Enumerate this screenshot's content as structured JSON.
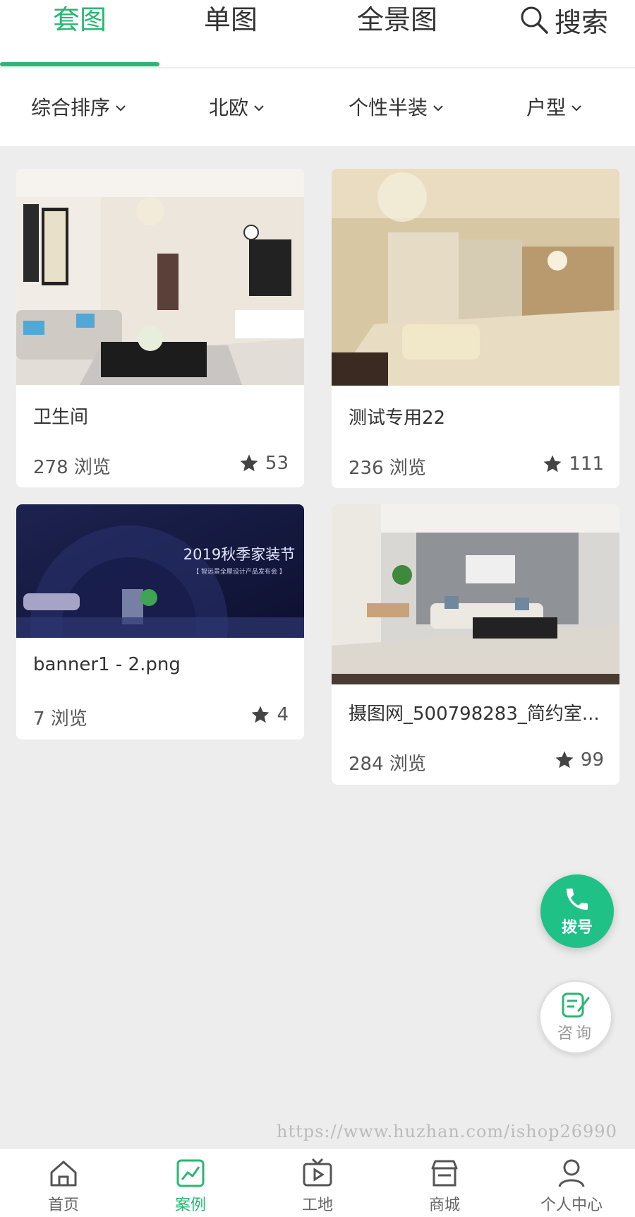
{
  "tabs": {
    "items": [
      {
        "label": "套图",
        "active": true
      },
      {
        "label": "单图",
        "active": false
      },
      {
        "label": "全景图",
        "active": false
      }
    ],
    "search_label": "搜索"
  },
  "filters": [
    {
      "label": "综合排序"
    },
    {
      "label": "北欧"
    },
    {
      "label": "个性半装"
    },
    {
      "label": "户型"
    }
  ],
  "cards": [
    {
      "title": "卫生间",
      "views": "278 浏览",
      "favorites": "53"
    },
    {
      "title": "测试专用22",
      "views": "236 浏览",
      "favorites": "111"
    },
    {
      "title": "banner1 - 2.png",
      "views": "7 浏览",
      "favorites": "4",
      "banner_text": "2019秋季家装节",
      "banner_sub": "【 智远景全屋设计产品发布会 】"
    },
    {
      "title": "摄图网_500798283_简约室...",
      "views": "284 浏览",
      "favorites": "99"
    }
  ],
  "fab": {
    "call_label": "拨号",
    "consult_label": "咨询"
  },
  "watermark": "https://www.huzhan.com/ishop26990",
  "bottom_nav": [
    {
      "label": "首页",
      "icon": "home-icon",
      "active": false
    },
    {
      "label": "案例",
      "icon": "chart-icon",
      "active": true
    },
    {
      "label": "工地",
      "icon": "tv-play-icon",
      "active": false
    },
    {
      "label": "商城",
      "icon": "store-icon",
      "active": false
    },
    {
      "label": "个人中心",
      "icon": "user-icon",
      "active": false
    }
  ],
  "colors": {
    "accent": "#2bb673",
    "fab_green": "#1fc187",
    "background": "#ededed"
  }
}
